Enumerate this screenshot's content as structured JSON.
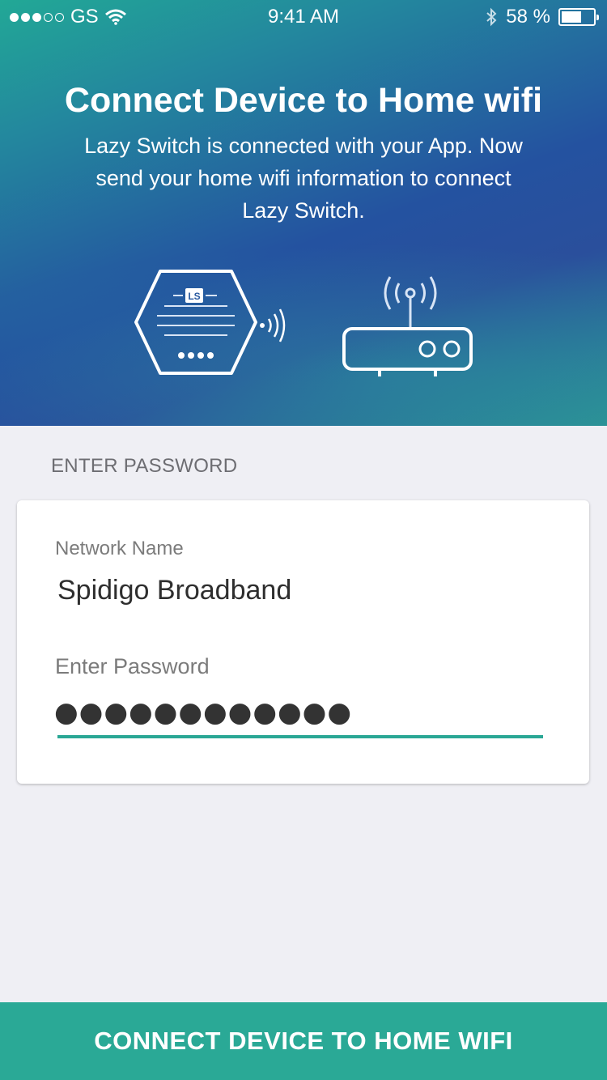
{
  "status_bar": {
    "carrier": "GS",
    "time": "9:41 AM",
    "battery_text": "58 %",
    "battery_level": 0.58,
    "signal_filled": 3,
    "signal_total": 5,
    "icons": [
      "wifi-icon",
      "bluetooth-icon",
      "battery-icon"
    ]
  },
  "header": {
    "title": "Connect Device to Home wifi",
    "subtitle": "Lazy Switch is connected with your App. Now send your home wifi information to connect Lazy Switch.",
    "device_badge": "LS"
  },
  "form": {
    "section_label": "ENTER PASSWORD",
    "network_label": "Network Name",
    "network_value": "Spidigo Broadband",
    "password_label": "Enter Password",
    "password_value": "●●●●●●●●●●●●"
  },
  "footer": {
    "button_label": "CONNECT DEVICE TO HOME WIFI"
  },
  "colors": {
    "accent": "#2aa996",
    "hero_start": "#22a896",
    "hero_mid": "#2452a0",
    "background": "#efeff4"
  }
}
